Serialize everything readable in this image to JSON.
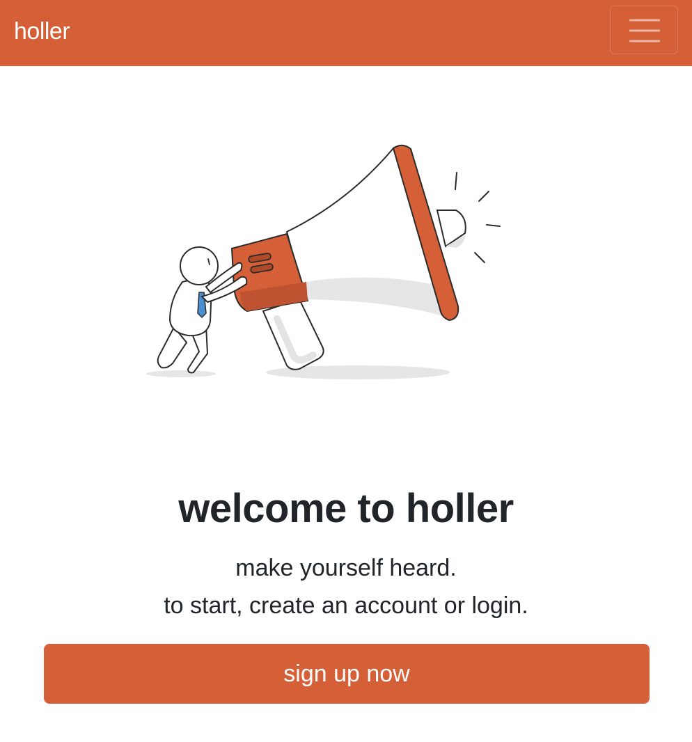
{
  "navbar": {
    "brand": "holler",
    "menu_icon": "hamburger-menu-icon"
  },
  "hero": {
    "illustration": "person-pushing-megaphone-illustration"
  },
  "main": {
    "title": "welcome to holler",
    "subtitle_line1": "make yourself heard.",
    "subtitle_line2": "to start, create an account or login.",
    "cta_label": "sign up now"
  },
  "colors": {
    "accent": "#d55f37",
    "text": "#212529",
    "background": "#ffffff"
  }
}
